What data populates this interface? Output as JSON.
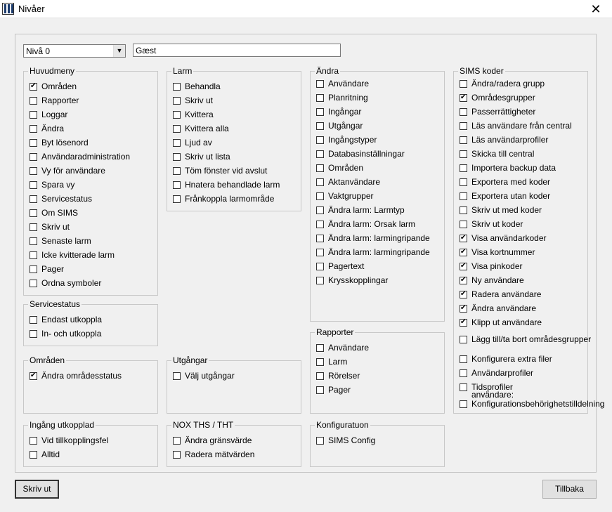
{
  "window": {
    "title": "Nivåer",
    "close": "✕"
  },
  "level_select": {
    "value": "Nivå 0",
    "arrow": "▼"
  },
  "name_field": {
    "value": "Gæst"
  },
  "groups": {
    "huvudmeny": {
      "title": "Huvudmeny",
      "items": [
        {
          "label": "Områden",
          "checked": true
        },
        {
          "label": "Rapporter",
          "checked": false
        },
        {
          "label": "Loggar",
          "checked": false
        },
        {
          "label": "Ändra",
          "checked": false
        },
        {
          "label": "Byt lösenord",
          "checked": false
        },
        {
          "label": "Användaradministration",
          "checked": false
        },
        {
          "label": "Vy för användare",
          "checked": false
        },
        {
          "label": "Spara vy",
          "checked": false
        },
        {
          "label": "Servicestatus",
          "checked": false
        },
        {
          "label": "Om SIMS",
          "checked": false
        },
        {
          "label": "Skriv ut",
          "checked": false
        },
        {
          "label": "Senaste larm",
          "checked": false
        },
        {
          "label": "Icke kvitterade larm",
          "checked": false
        },
        {
          "label": "Pager",
          "checked": false
        },
        {
          "label": "Ordna symboler",
          "checked": false
        }
      ]
    },
    "servicestatus": {
      "title": "Servicestatus",
      "items": [
        {
          "label": "Endast utkoppla",
          "checked": false
        },
        {
          "label": "In- och utkoppla",
          "checked": false
        }
      ]
    },
    "omraden": {
      "title": "Områden",
      "items": [
        {
          "label": "Ändra områdesstatus",
          "checked": true
        }
      ]
    },
    "ingang_utkopplad": {
      "title": "Ingång utkopplad",
      "items": [
        {
          "label": "Vid tillkopplingsfel",
          "checked": false
        },
        {
          "label": "Alltid",
          "checked": false
        }
      ]
    },
    "larm": {
      "title": "Larm",
      "items": [
        {
          "label": "Behandla",
          "checked": false
        },
        {
          "label": "Skriv ut",
          "checked": false
        },
        {
          "label": "Kvittera",
          "checked": false
        },
        {
          "label": "Kvittera alla",
          "checked": false
        },
        {
          "label": "Ljud av",
          "checked": false
        },
        {
          "label": "Skriv ut lista",
          "checked": false
        },
        {
          "label": "Töm fönster vid avslut",
          "checked": false
        },
        {
          "label": "Hnatera behandlade larm",
          "checked": false
        },
        {
          "label": "Frånkoppla larmområde",
          "checked": false
        }
      ]
    },
    "utgangar": {
      "title": "Utgångar",
      "items": [
        {
          "label": "Välj utgångar",
          "checked": false
        }
      ]
    },
    "nox": {
      "title": "NOX THS / THT",
      "items": [
        {
          "label": "Ändra gränsvärde",
          "checked": false
        },
        {
          "label": "Radera mätvärden",
          "checked": false
        }
      ]
    },
    "andra": {
      "title": "Ändra",
      "items": [
        {
          "label": "Användare",
          "checked": false
        },
        {
          "label": "Planritning",
          "checked": false
        },
        {
          "label": "Ingångar",
          "checked": false
        },
        {
          "label": "Utgångar",
          "checked": false
        },
        {
          "label": "Ingångstyper",
          "checked": false
        },
        {
          "label": "Databasinställningar",
          "checked": false
        },
        {
          "label": "Områden",
          "checked": false
        },
        {
          "label": "Aktanvändare",
          "checked": false
        },
        {
          "label": "Vaktgrupper",
          "checked": false
        },
        {
          "label": "Ändra larm: Larmtyp",
          "checked": false
        },
        {
          "label": "Ändra larm: Orsak larm",
          "checked": false
        },
        {
          "label": "Ändra larm: larmingripande",
          "checked": false
        },
        {
          "label": "Ändra larm: larmingripande",
          "checked": false
        },
        {
          "label": "Pagertext",
          "checked": false
        },
        {
          "label": "Krysskopplingar",
          "checked": false
        }
      ]
    },
    "rapporter": {
      "title": "Rapporter",
      "items": [
        {
          "label": "Användare",
          "checked": false
        },
        {
          "label": "Larm",
          "checked": false
        },
        {
          "label": "Rörelser",
          "checked": false
        },
        {
          "label": "Pager",
          "checked": false
        }
      ]
    },
    "konfiguration": {
      "title": "Konfiguratuon",
      "items": [
        {
          "label": "SIMS Config",
          "checked": false
        }
      ]
    },
    "sims_koder": {
      "title": "SIMS koder",
      "items": [
        {
          "label": "Ändra/radera grupp",
          "checked": false
        },
        {
          "label": "Områdesgrupper",
          "checked": true
        },
        {
          "label": "Passerrättigheter",
          "checked": false
        },
        {
          "label": "Läs användare från central",
          "checked": false
        },
        {
          "label": "Läs användarprofiler",
          "checked": false
        },
        {
          "label": "Skicka till central",
          "checked": false
        },
        {
          "label": "Importera backup data",
          "checked": false
        },
        {
          "label": "Exportera med koder",
          "checked": false
        },
        {
          "label": "Exportera utan koder",
          "checked": false
        },
        {
          "label": "Skriv ut med koder",
          "checked": false
        },
        {
          "label": "Skriv ut koder",
          "checked": false
        },
        {
          "label": "Visa användarkoder",
          "checked": true
        },
        {
          "label": "Visa kortnummer",
          "checked": true
        },
        {
          "label": "Visa pinkoder",
          "checked": true
        },
        {
          "label": "Ny användare",
          "checked": true
        },
        {
          "label": "Radera användare",
          "checked": true
        },
        {
          "label": "Ändra användare",
          "checked": true
        },
        {
          "label": "Klipp ut användare",
          "checked": true
        },
        {
          "label": "Lägg till/ta bort områdesgrupper",
          "checked": false
        },
        {
          "label": "Konfigurera extra filer",
          "checked": false
        },
        {
          "label": "Användarprofiler",
          "checked": false
        },
        {
          "label": "Tidsprofiler",
          "checked": false
        },
        {
          "label": "Konfigurationsbehörighetstilldelning",
          "checked": false
        }
      ],
      "overlap_text": "användare:"
    }
  },
  "buttons": {
    "print": "Skriv ut",
    "back": "Tillbaka"
  }
}
